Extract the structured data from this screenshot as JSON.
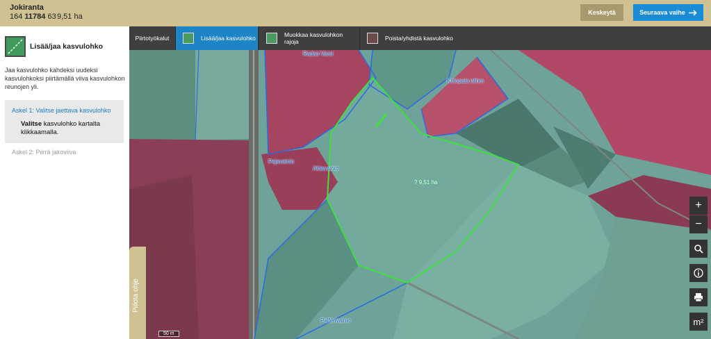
{
  "header": {
    "farm_name": "Jokiranta",
    "farm_id_prefix": "164",
    "farm_id_bold": "11784",
    "farm_id_suffix": "63",
    "farm_area": "9,51 ha",
    "stop_label": "Keskeytä",
    "next_label": "Seuraava vaihe",
    "next_icon": "arrow-right-icon",
    "accent_color": "#1a8bd6",
    "bar_color": "#cfc192"
  },
  "sidebar": {
    "title": "Lisää/jaa kasvulohko",
    "description": "Jaa kasvulohko kahdeksi uudeksi kasvulohkoksi piirtämällä viiva kasvulohkon reunojen yli.",
    "step1": {
      "title": "Askel 1: Valitse jaettava kasvulohko",
      "text_bold": "Valitse",
      "text_rest": " kasvulohko kartalta klikkaamalla."
    },
    "step2": {
      "title": "Askel 2: Piirrä jakoviiva"
    }
  },
  "toolbar": {
    "tools": [
      {
        "label": "Piirtotyökalut",
        "icon": ""
      },
      {
        "label": "Lisää/jaa kasvulohko",
        "icon": "split-parcel-icon",
        "active": true
      },
      {
        "label": "Muokkaa kasvulohkon rajoja",
        "icon": "edit-border-icon"
      },
      {
        "label": "Poista/yhdistä kasvulohko",
        "icon": "merge-parcel-icon"
      }
    ]
  },
  "map": {
    "labels": {
      "radan_varsi": "Radan Varsi",
      "kotopala": "Kotopala niihm",
      "pajavainio": "Pajavainio",
      "alttavainio": "Alttavainio",
      "palferivainio": "Palferivainio"
    },
    "selected_area": "? 9,51 ha",
    "scale": "50 m",
    "controls": [
      "zoom-in-icon",
      "zoom-out-icon",
      "search-icon",
      "info-icon",
      "print-icon",
      "measure-area-icon"
    ],
    "zoom_in_glyph": "+",
    "zoom_out_glyph": "−",
    "measure_glyph": "m²"
  },
  "help_tab": {
    "label": "Piilota ohje"
  }
}
